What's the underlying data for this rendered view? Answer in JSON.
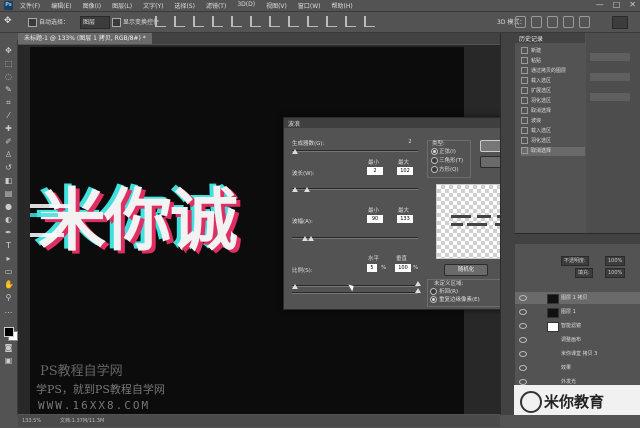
{
  "app": {
    "logo": "Ps",
    "menu": [
      "文件(F)",
      "编辑(E)",
      "图像(I)",
      "图层(L)",
      "文字(Y)",
      "选择(S)",
      "滤镜(T)",
      "3D(D)",
      "视图(V)",
      "窗口(W)",
      "帮助(H)"
    ],
    "window_controls": [
      "—",
      "□",
      "✕"
    ]
  },
  "options_bar": {
    "auto_select_label": "自动选择：",
    "auto_select_value": "图层",
    "show_transform_label": "显示变换控件",
    "mode_3d_label": "3D 模式："
  },
  "document": {
    "tab_label": "未标题-1 @ 133% (图层 1 拷贝, RGB/8#) *",
    "canvas_text": "米你诚",
    "watermark_site": "PS教程自学网",
    "watermark_slogan": "学PS，就到PS教程自学网",
    "watermark_url": "WWW.16XX8.COM",
    "zoom": "133.5%",
    "doc_size": "文档:1.37M/11.3M"
  },
  "dialog": {
    "title": "波浪",
    "generators_label": "生成器数(G):",
    "generators_value": "2",
    "wavelength_label": "波长(W):",
    "amplitude_label": "波幅(A):",
    "min_label": "最小",
    "max_label": "最大",
    "wavelength_min": "2",
    "wavelength_max": "102",
    "amplitude_min": "90",
    "amplitude_max": "133",
    "scale_label": "比例(S):",
    "horizontal_label": "水平",
    "vertical_label": "垂直",
    "scale_h": "5",
    "scale_h_unit": "%",
    "scale_v": "100",
    "scale_v_unit": "%",
    "type_label": "类型:",
    "type_options": [
      "正弦(I)",
      "三角形(T)",
      "方形(Q)"
    ],
    "type_selected": 0,
    "ok_label": "确定",
    "cancel_label": "取消",
    "randomize_label": "随机化",
    "undefined_area_label": "未定义区域:",
    "undefined_options": [
      "折回(R)",
      "重复边缘像素(E)"
    ],
    "undefined_selected": 1
  },
  "history_panel": {
    "tab_label": "历史记录",
    "items": [
      "新建",
      "粘贴",
      "通过拷贝的图层",
      "载入选区",
      "扩展选区",
      "羽化选区",
      "取消选择",
      "波浪",
      "载入选区",
      "羽化选区",
      "取消选择"
    ]
  },
  "layers_panel": {
    "opacity_label": "不透明度:",
    "opacity_value": "100%",
    "fill_label": "填充:",
    "fill_value": "100%",
    "layers": [
      {
        "name": "图层 1 拷贝",
        "thumb": "dark",
        "selected": true
      },
      {
        "name": "图层 1",
        "thumb": "dark",
        "selected": false
      },
      {
        "name": "智能滤镜",
        "thumb": "light",
        "selected": false
      },
      {
        "name": "调整画布",
        "thumb": "none",
        "selected": false
      },
      {
        "name": "米你课堂 拷贝 3",
        "thumb": "text",
        "selected": false
      },
      {
        "name": "效果",
        "thumb": "none",
        "selected": false
      },
      {
        "name": "外发光",
        "thumb": "none",
        "selected": false
      }
    ]
  },
  "brand": {
    "label": "米你教育"
  },
  "colors": {
    "cyan": "#3fe0e0",
    "red": "#e02e62",
    "panel": "#535353"
  }
}
